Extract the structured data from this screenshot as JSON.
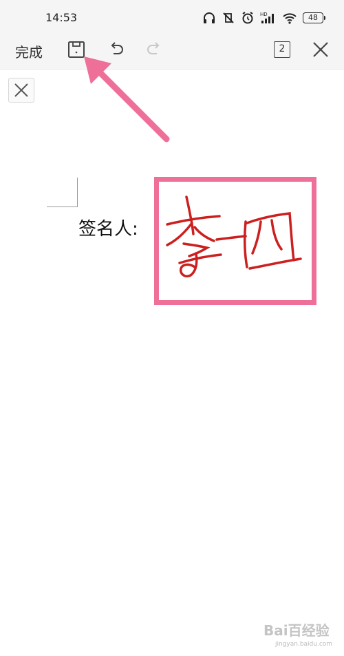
{
  "status_bar": {
    "time": "14:53",
    "battery": "48",
    "icons": [
      "headphones-icon",
      "mute-vibrate-icon",
      "alarm-icon",
      "hd-signal-icon",
      "wifi-icon",
      "battery-icon"
    ]
  },
  "toolbar": {
    "done_label": "完成",
    "save_icon": "save-icon",
    "undo_icon": "undo-icon",
    "redo_icon": "redo-icon",
    "page_count": "2",
    "close_icon": "close-icon"
  },
  "document": {
    "signer_label": "签名人:",
    "signature_text": "李四"
  },
  "colors": {
    "highlight": "#ee6f98",
    "ink": "#cc1f1f",
    "toolbar_bg": "#f5f5f5"
  },
  "watermark": {
    "brand": "Bai百经验",
    "site": "jingyan.baidu.com"
  }
}
